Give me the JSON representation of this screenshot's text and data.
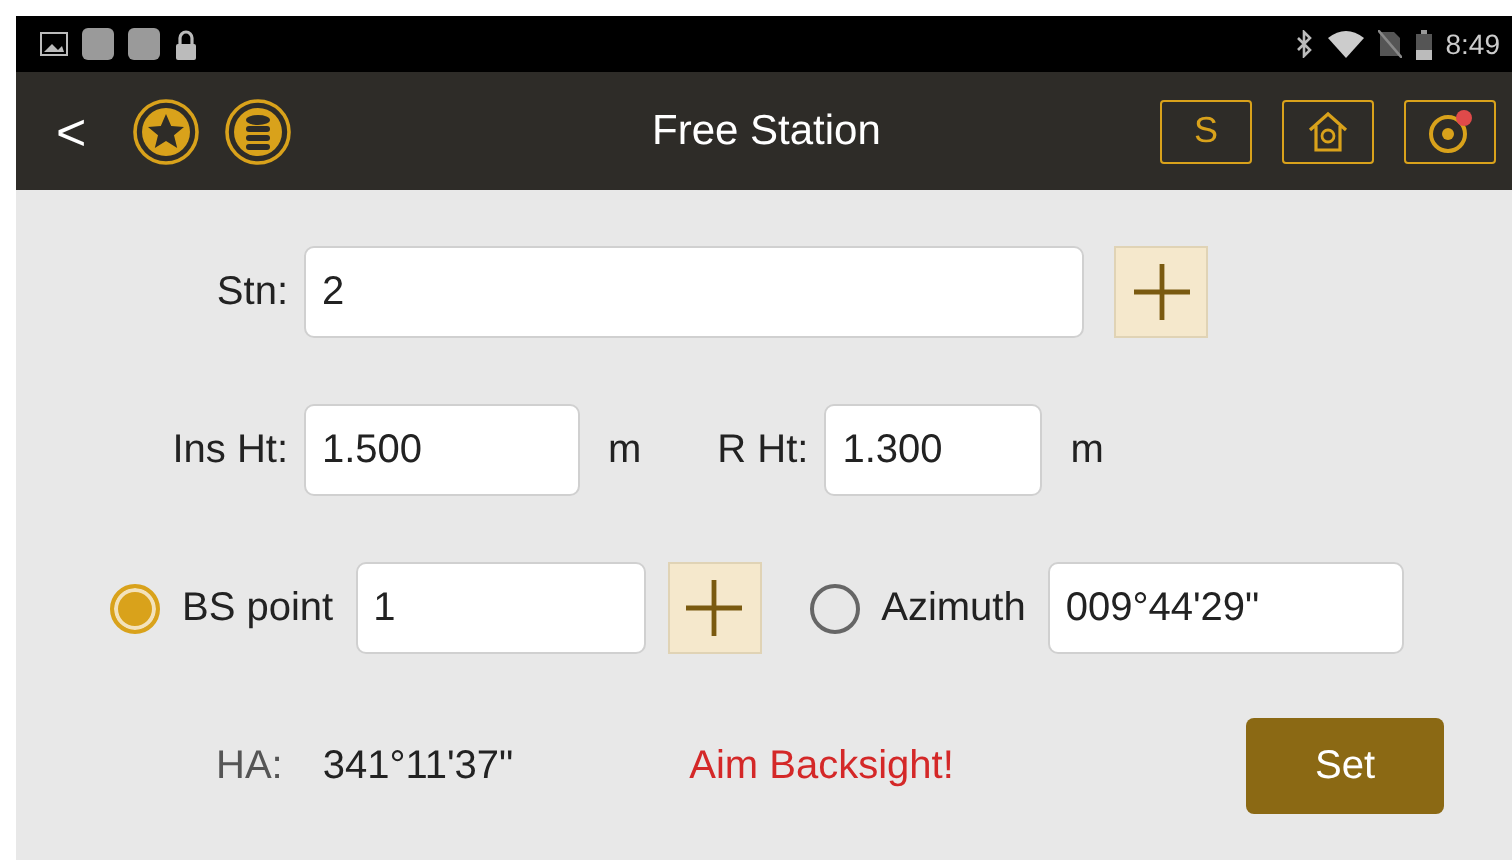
{
  "status_bar": {
    "time": "8:49"
  },
  "app_bar": {
    "back": "<",
    "title": "Free Station",
    "buttons": [
      {
        "kind": "text",
        "label": "S"
      },
      {
        "kind": "home"
      },
      {
        "kind": "target"
      }
    ]
  },
  "station": {
    "label": "Stn:",
    "value": "2"
  },
  "heights": [
    {
      "label": "Ins Ht:",
      "value": "1.500",
      "unit": "m"
    },
    {
      "label": "R Ht:",
      "value": "1.300",
      "unit": "m"
    }
  ],
  "backsight": [
    {
      "kind": "point",
      "label": "BS point",
      "value": "1",
      "selected": true
    },
    {
      "kind": "azimuth",
      "label": "Azimuth",
      "value": "009°44'29\"",
      "selected": false
    }
  ],
  "ha": {
    "label": "HA:",
    "value": "341°11'37\""
  },
  "message": "Aim Backsight!",
  "set_button": "Set"
}
